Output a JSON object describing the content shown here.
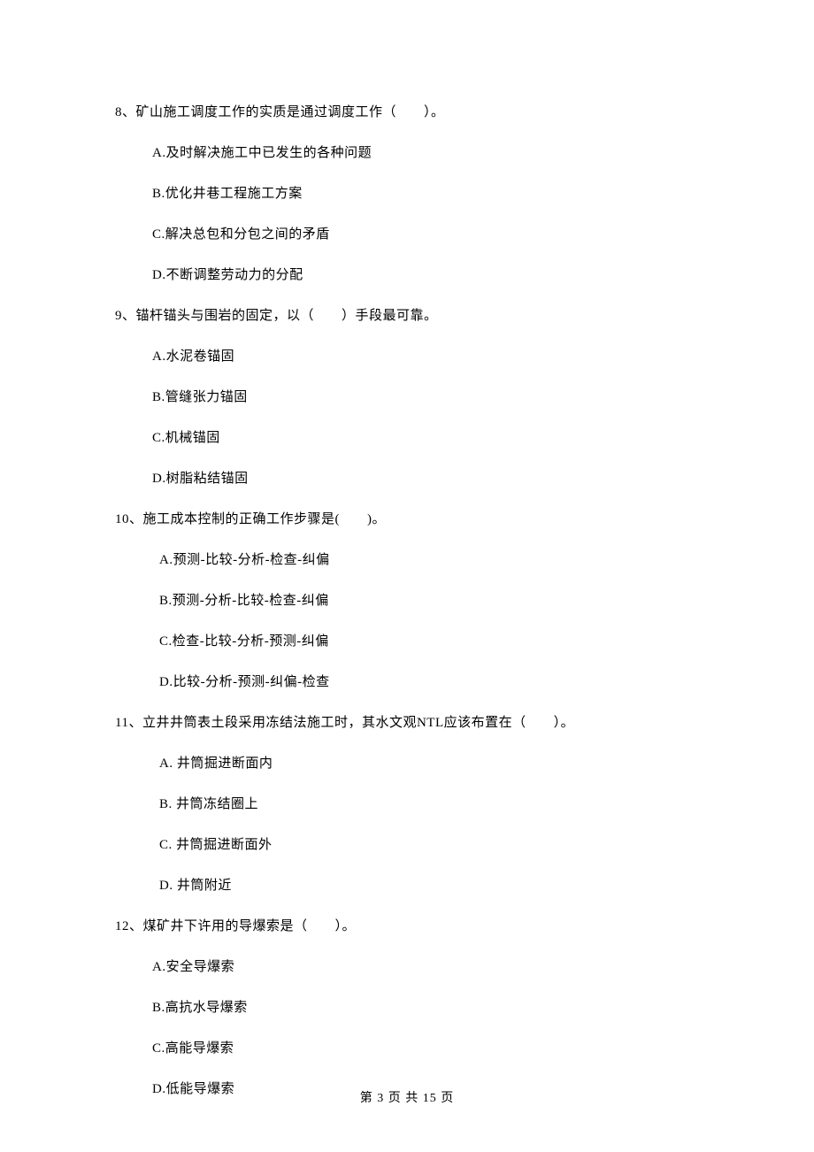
{
  "questions": [
    {
      "stem": "8、矿山施工调度工作的实质是通过调度工作（　　）。",
      "options": [
        "A.及时解决施工中已发生的各种问题",
        "B.优化井巷工程施工方案",
        "C.解决总包和分包之间的矛盾",
        "D.不断调整劳动力的分配"
      ]
    },
    {
      "stem": "9、锚杆锚头与围岩的固定，以（　　）手段最可靠。",
      "options": [
        "A.水泥卷锚固",
        "B.管缝张力锚固",
        "C.机械锚固",
        "D.树脂粘结锚固"
      ]
    },
    {
      "stem": "10、施工成本控制的正确工作步骤是(　　)。",
      "options": [
        "A.预测-比较-分析-检查-纠偏",
        "B.预测-分析-比较-检查-纠偏",
        "C.检查-比较-分析-预测-纠偏",
        "D.比较-分析-预测-纠偏-检查"
      ]
    },
    {
      "stem": "11、立井井筒表土段采用冻结法施工时，其水文观NTL应该布置在（　　）。",
      "options": [
        "A.  井筒掘进断面内",
        "B.  井筒冻结圈上",
        "C.  井筒掘进断面外",
        "D.  井筒附近"
      ]
    },
    {
      "stem": "12、煤矿井下许用的导爆索是（　　）。",
      "options": [
        "A.安全导爆索",
        "B.高抗水导爆索",
        "C.高能导爆索",
        "D.低能导爆索"
      ]
    }
  ],
  "footer": "第 3 页 共 15 页"
}
